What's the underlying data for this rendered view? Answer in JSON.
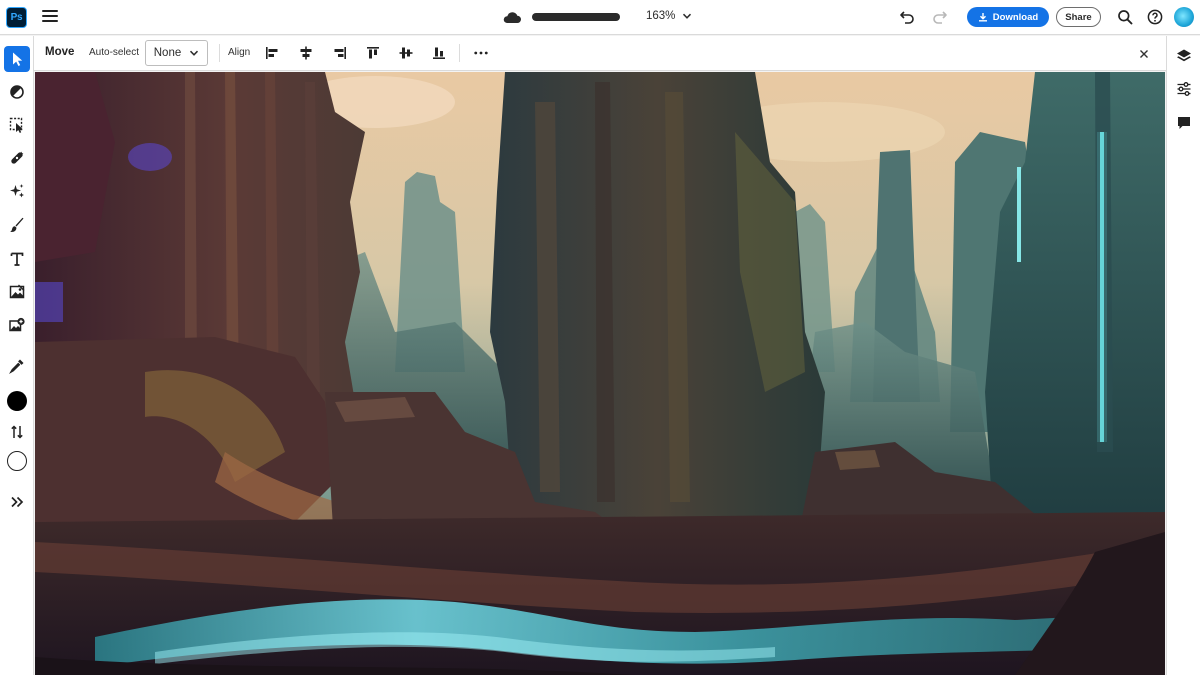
{
  "app": {
    "logo_text": "Ps"
  },
  "header": {
    "zoom_label": "163%",
    "download_label": "Download",
    "share_label": "Share"
  },
  "options_bar": {
    "tool_label": "Move",
    "auto_select_label": "Auto-select",
    "auto_select_value": "None",
    "align_label": "Align"
  },
  "left_tools": [
    {
      "name": "move-tool",
      "icon": "arrow-pointer-icon",
      "active": true
    },
    {
      "name": "adjust-tool",
      "icon": "half-circle-icon"
    },
    {
      "name": "select-tool",
      "icon": "selection-icon"
    },
    {
      "name": "healing-tool",
      "icon": "bandage-icon"
    },
    {
      "name": "generative-fill-tool",
      "icon": "sparkle-icon"
    },
    {
      "name": "brush-tool",
      "icon": "brush-icon"
    },
    {
      "name": "type-tool",
      "icon": "text-icon"
    },
    {
      "name": "image-tool",
      "icon": "image-icon"
    },
    {
      "name": "add-image-tool",
      "icon": "add-image-icon"
    },
    {
      "name": "eyedropper-tool",
      "icon": "eyedropper-icon"
    }
  ],
  "colors": {
    "accent": "#1473e6",
    "foreground_color": "#000000",
    "background_color": "#ffffff",
    "logo_bg": "#001e36",
    "logo_fg": "#31a8ff"
  },
  "right_panel": [
    {
      "name": "layers-button",
      "icon": "layers-icon"
    },
    {
      "name": "adjustments-button",
      "icon": "sliders-icon"
    },
    {
      "name": "comments-button",
      "icon": "comment-icon"
    }
  ]
}
